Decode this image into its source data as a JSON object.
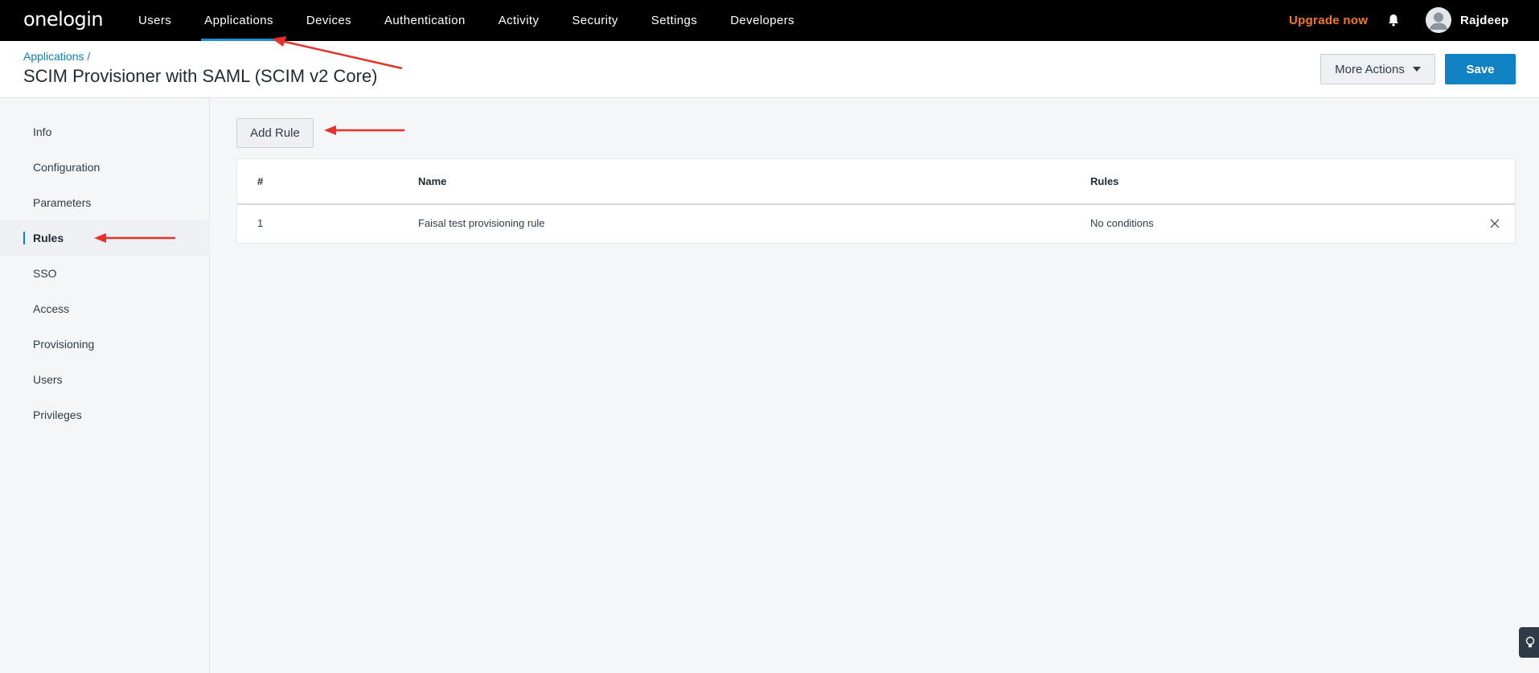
{
  "topnav": {
    "logo": "onelogin",
    "items": [
      "Users",
      "Applications",
      "Devices",
      "Authentication",
      "Activity",
      "Security",
      "Settings",
      "Developers"
    ],
    "active": "Applications",
    "upgrade": "Upgrade now",
    "user": "Rajdeep"
  },
  "header": {
    "breadcrumb": "Applications /",
    "title": "SCIM Provisioner with SAML (SCIM v2 Core)",
    "more_actions": "More Actions",
    "save": "Save"
  },
  "sidebar": {
    "items": [
      "Info",
      "Configuration",
      "Parameters",
      "Rules",
      "SSO",
      "Access",
      "Provisioning",
      "Users",
      "Privileges"
    ],
    "active": "Rules"
  },
  "main": {
    "add_rule": "Add Rule",
    "table": {
      "headers": [
        "#",
        "Name",
        "Rules"
      ],
      "rows": [
        {
          "num": "1",
          "name": "Faisal test provisioning rule",
          "rules": "No conditions"
        }
      ]
    }
  },
  "colors": {
    "accent": "#1182c3",
    "upgrade": "#f5762d",
    "annotation_arrow": "#e8312a"
  }
}
